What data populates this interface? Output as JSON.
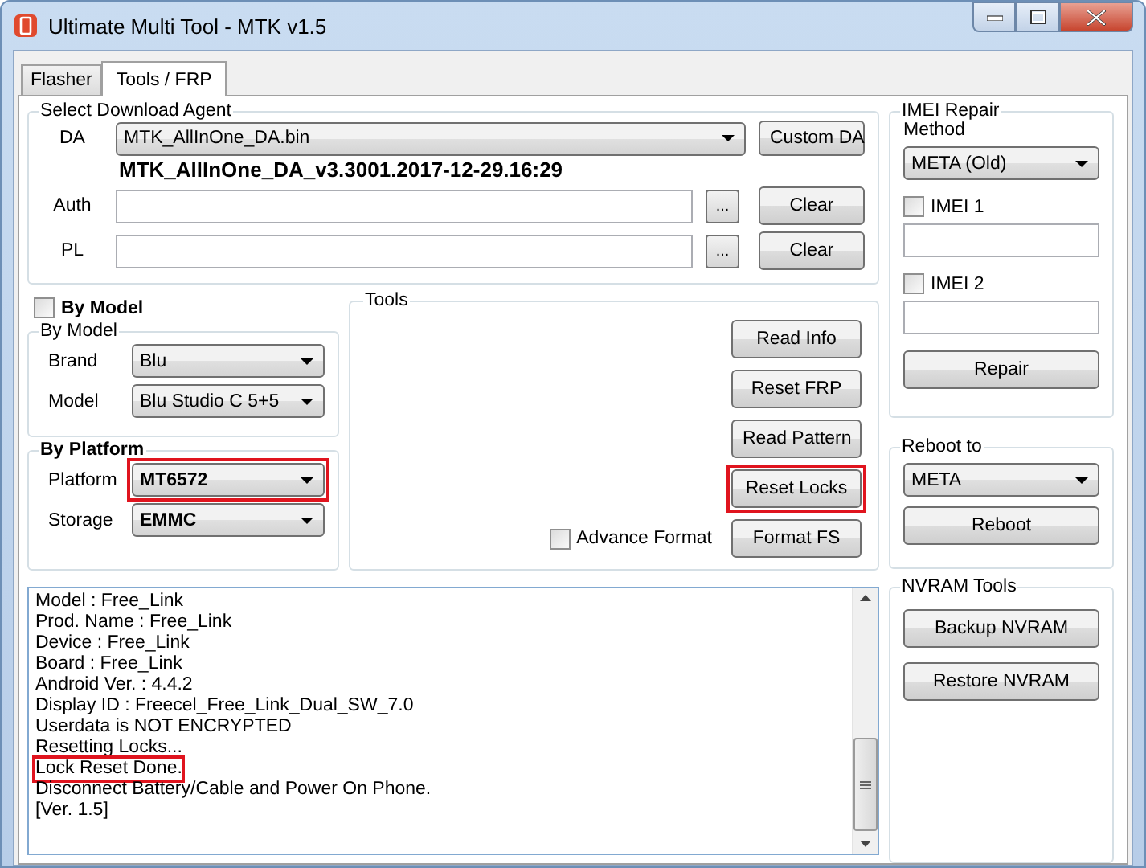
{
  "window": {
    "title": "Ultimate Multi Tool - MTK v1.5"
  },
  "tabs": [
    {
      "label": "Flasher",
      "selected": false
    },
    {
      "label": "Tools / FRP",
      "selected": true
    }
  ],
  "download_agent": {
    "title": "Select Download Agent",
    "rows": [
      {
        "kind": "dropdown",
        "label": "DA",
        "value": "MTK_AllInOne_DA.bin",
        "button": "Custom DA"
      },
      {
        "kind": "info",
        "value": "MTK_AllInOne_DA_v3.3001.2017-12-29.16:29"
      },
      {
        "kind": "file",
        "label": "Auth",
        "browse": "...",
        "button": "Clear"
      },
      {
        "kind": "file",
        "label": "PL",
        "browse": "...",
        "button": "Clear"
      }
    ]
  },
  "by_model_toggle": {
    "label": "By Model",
    "checked": false
  },
  "by_model": {
    "title": "By Model",
    "fields": [
      {
        "label": "Brand",
        "value": "Blu",
        "highlighted": false
      },
      {
        "label": "Model",
        "value": "Blu Studio C 5+5",
        "highlighted": false
      }
    ]
  },
  "by_platform": {
    "title": "By Platform",
    "fields": [
      {
        "label": "Platform",
        "value": "MT6572",
        "highlighted": true
      },
      {
        "label": "Storage",
        "value": "EMMC",
        "highlighted": false
      }
    ]
  },
  "tools": {
    "title": "Tools",
    "advance_format": {
      "label": "Advance Format",
      "checked": false
    },
    "buttons": [
      {
        "label": "Read Info",
        "highlighted": false
      },
      {
        "label": "Reset FRP",
        "highlighted": false
      },
      {
        "label": "Read Pattern",
        "highlighted": false
      },
      {
        "label": "Reset Locks",
        "highlighted": true
      },
      {
        "label": "Format FS",
        "highlighted": false
      }
    ]
  },
  "log": {
    "lines": [
      {
        "text": "Model : Free_Link",
        "highlighted": false
      },
      {
        "text": "Prod. Name : Free_Link",
        "highlighted": false
      },
      {
        "text": "Device : Free_Link",
        "highlighted": false
      },
      {
        "text": "Board : Free_Link",
        "highlighted": false
      },
      {
        "text": "Android Ver. : 4.4.2",
        "highlighted": false
      },
      {
        "text": "Display ID : Freecel_Free_Link_Dual_SW_7.0",
        "highlighted": false
      },
      {
        "text": "Userdata is NOT ENCRYPTED",
        "highlighted": false
      },
      {
        "text": "Resetting Locks...",
        "highlighted": false
      },
      {
        "text": "Lock Reset Done.",
        "highlighted": true
      },
      {
        "text": "Disconnect Battery/Cable and Power On Phone.",
        "highlighted": false
      },
      {
        "text": "[Ver. 1.5]",
        "highlighted": false
      }
    ]
  },
  "imei_repair": {
    "title": "IMEI Repair",
    "method_label": "Method",
    "method": "META (Old)",
    "imei": [
      {
        "label": "IMEI 1",
        "checked": false
      },
      {
        "label": "IMEI 2",
        "checked": false
      }
    ],
    "button": "Repair"
  },
  "reboot": {
    "title": "Reboot to",
    "mode": "META",
    "button": "Reboot"
  },
  "nvram": {
    "title": "NVRAM Tools",
    "buttons": [
      "Backup NVRAM",
      "Restore NVRAM"
    ]
  }
}
